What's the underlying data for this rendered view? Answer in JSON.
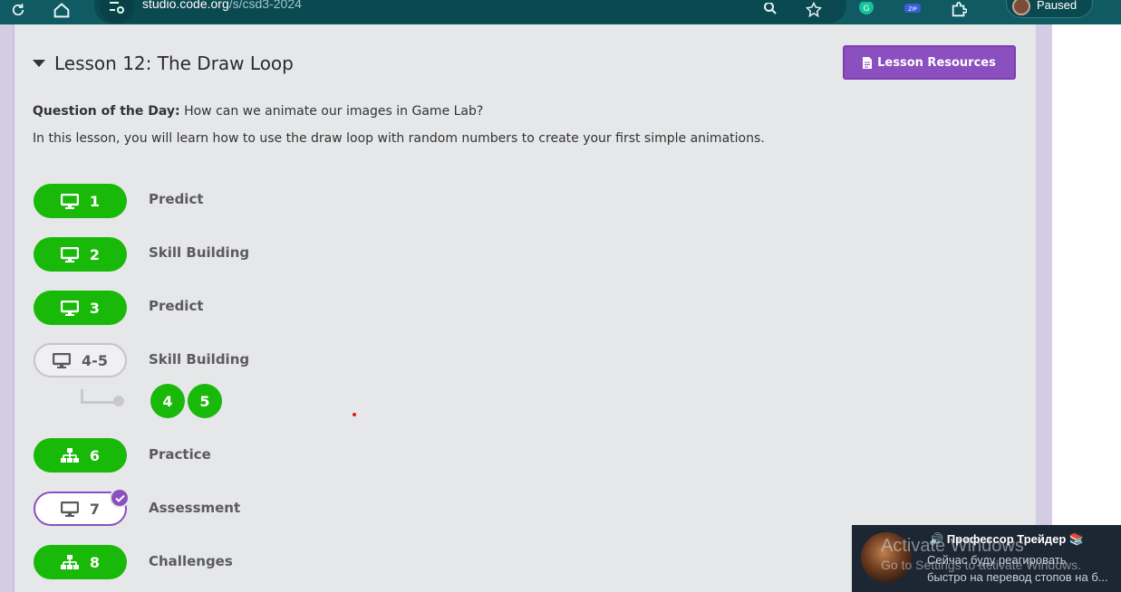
{
  "browser": {
    "url_host": "studio.code.org",
    "url_path": "/s/csd3-2024",
    "profile_status": "Paused",
    "icons": [
      "reload-icon",
      "home-icon",
      "site-settings-icon",
      "zoom-icon",
      "bookmark-star-icon",
      "grammarly-extension-icon",
      "zip-extension-icon",
      "extensions-puzzle-icon",
      "profile-avatar"
    ]
  },
  "lesson": {
    "title": "Lesson 12: The Draw Loop",
    "resources_button": "Lesson Resources",
    "qotd_label": "Question of the Day:",
    "qotd_text": " How can we animate our images in Game Lab?",
    "description": "In this lesson, you will learn how to use the draw loop with random numbers to create your first simple animations."
  },
  "activities": [
    {
      "number": "1",
      "label": "Predict",
      "icon": "monitor-icon",
      "status": "completed"
    },
    {
      "number": "2",
      "label": "Skill Building",
      "icon": "monitor-icon",
      "status": "completed"
    },
    {
      "number": "3",
      "label": "Predict",
      "icon": "monitor-icon",
      "status": "completed"
    },
    {
      "number": "4-5",
      "label": "Skill Building",
      "icon": "monitor-icon",
      "status": "not-started",
      "sublevels": [
        "4",
        "5"
      ]
    },
    {
      "number": "6",
      "label": "Practice",
      "icon": "sitemap-icon",
      "status": "completed"
    },
    {
      "number": "7",
      "label": "Assessment",
      "icon": "monitor-icon",
      "status": "submitted"
    },
    {
      "number": "8",
      "label": "Challenges",
      "icon": "sitemap-icon",
      "status": "completed"
    }
  ],
  "notification": {
    "title": "Профессор Трейдер",
    "line1": "Сейчас буду реагировать",
    "line2": "быстро на перевод стопов на б..."
  },
  "watermark": {
    "line1": "Activate Windows",
    "line2": "Go to Settings to activate Windows."
  },
  "colors": {
    "completed": "#19b90a",
    "accent": "#8b4fbf",
    "toolbar": "#0f5a63"
  }
}
